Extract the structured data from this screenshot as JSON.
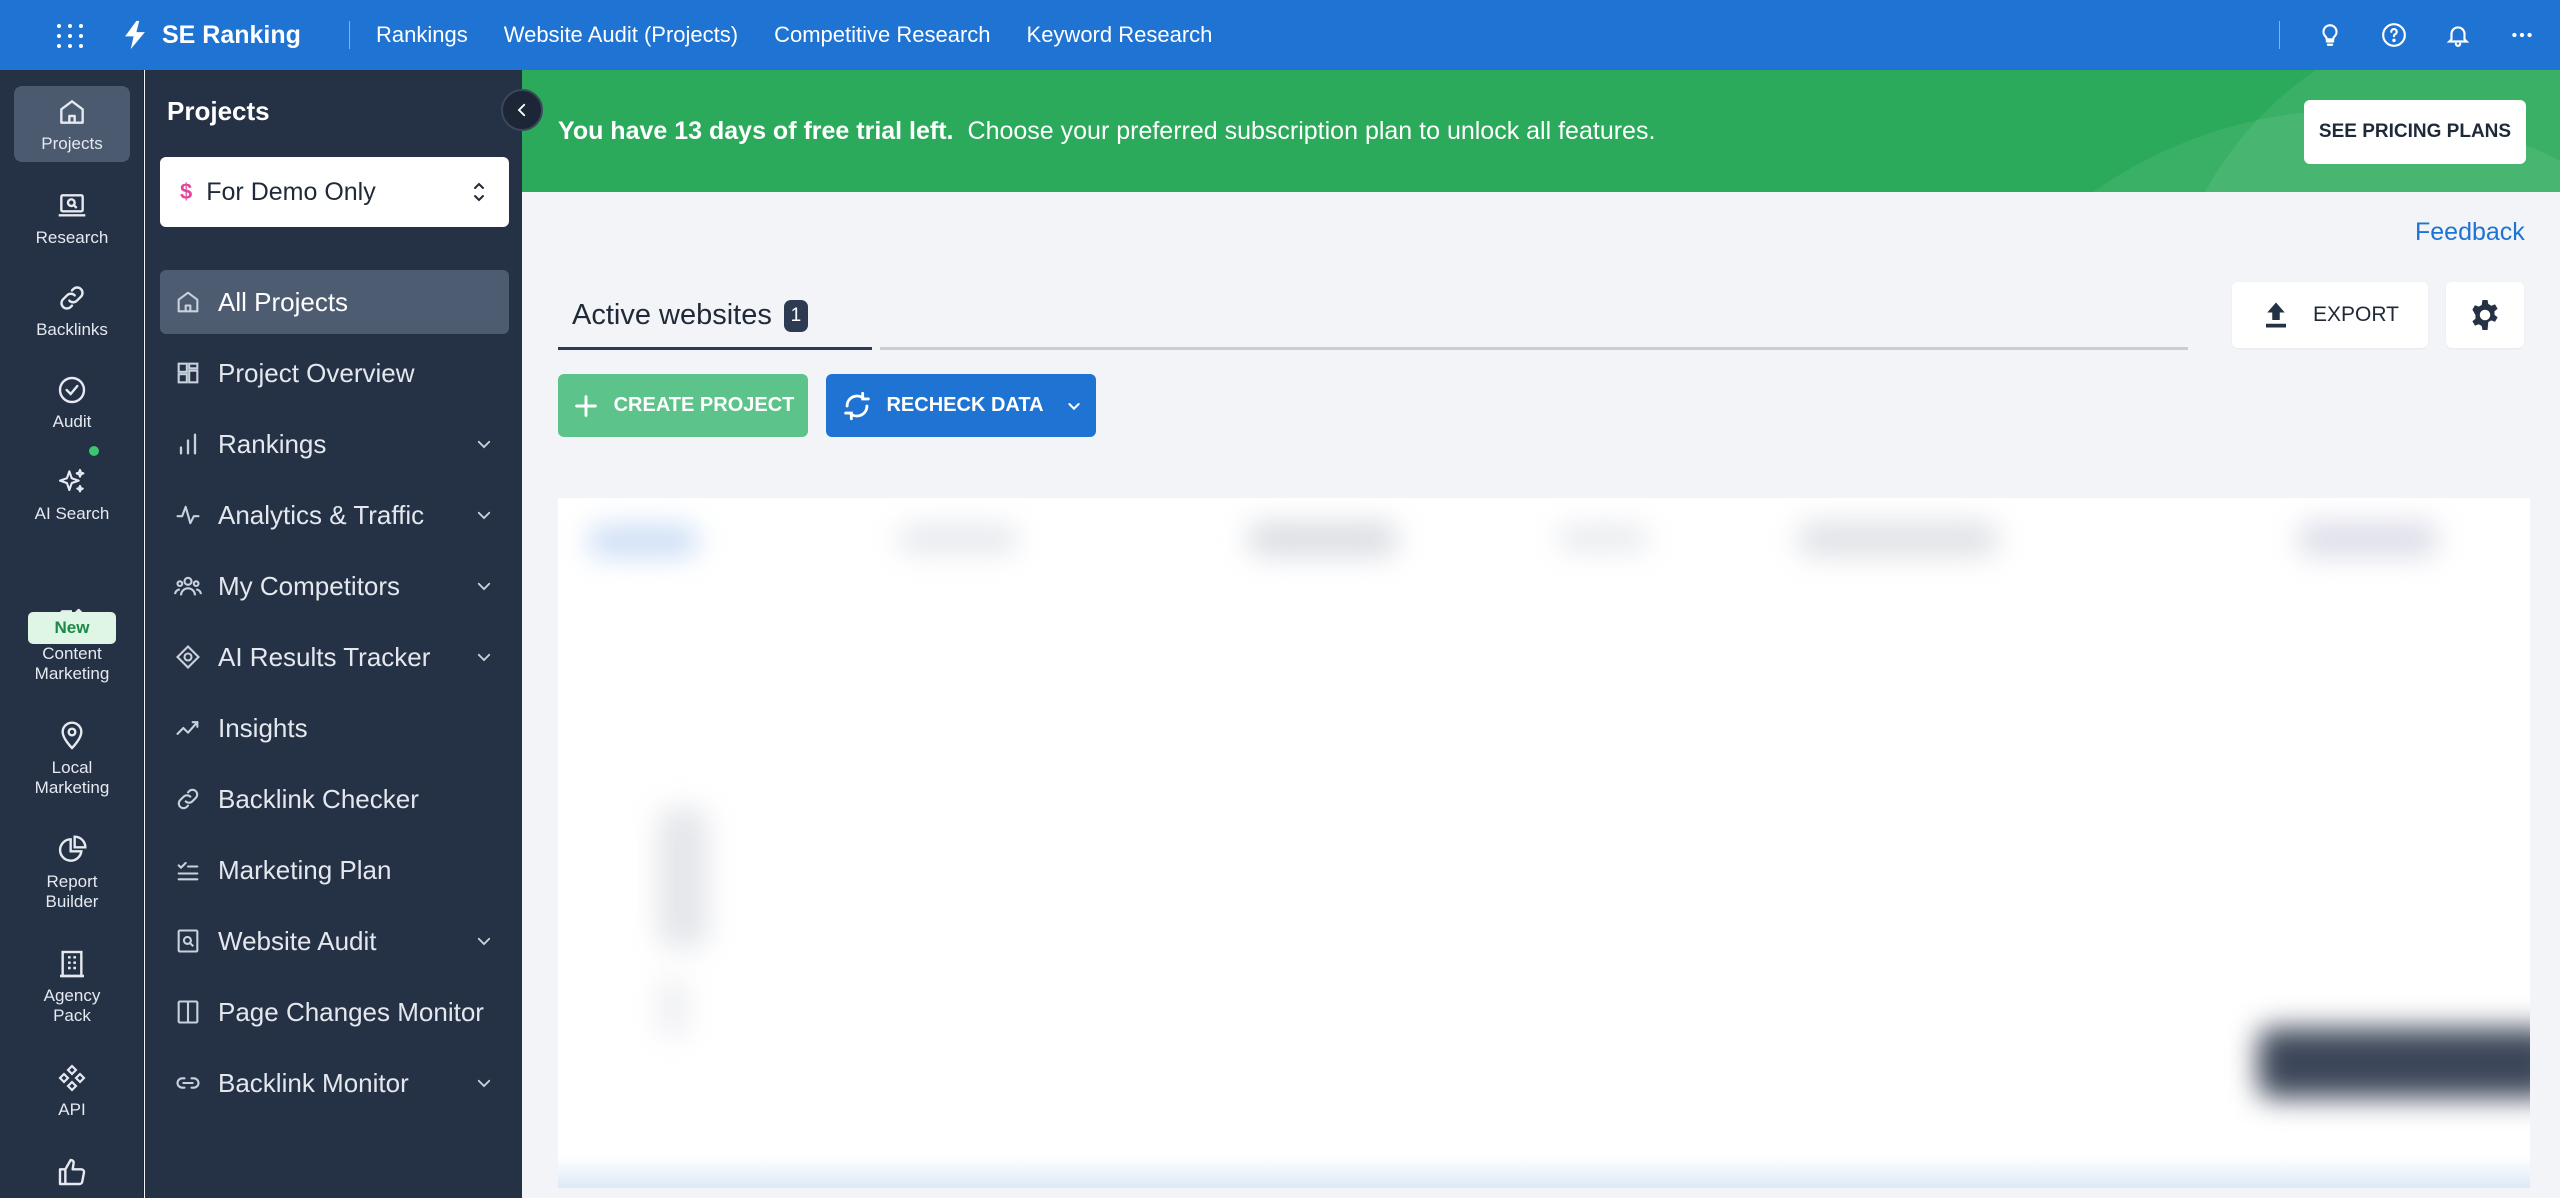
{
  "topbar": {
    "brand": "SE Ranking",
    "nav": [
      "Rankings",
      "Website Audit (Projects)",
      "Competitive Research",
      "Keyword Research"
    ],
    "icons": [
      "lightbulb-icon",
      "help-icon",
      "bell-icon",
      "more-icon"
    ]
  },
  "rail": {
    "items": [
      {
        "label": "Projects",
        "icon": "home-icon"
      },
      {
        "label": "Research",
        "icon": "research-icon"
      },
      {
        "label": "Backlinks",
        "icon": "link-icon"
      },
      {
        "label": "Audit",
        "icon": "check-circle-icon"
      },
      {
        "label": "AI Search",
        "icon": "sparkles-icon"
      },
      {
        "label": "Content\nMarketing",
        "icon": "edit-icon"
      },
      {
        "label": "Local\nMarketing",
        "icon": "map-pin-icon"
      },
      {
        "label": "Report\nBuilder",
        "icon": "pie-chart-icon"
      },
      {
        "label": "Agency\nPack",
        "icon": "building-icon"
      },
      {
        "label": "API",
        "icon": "api-icon"
      }
    ],
    "new_badge": "New"
  },
  "sidebar": {
    "title": "Projects",
    "project": {
      "symbol": "$",
      "name": "For Demo Only"
    },
    "items": [
      {
        "label": "All Projects",
        "icon": "home-icon",
        "expandable": false
      },
      {
        "label": "Project Overview",
        "icon": "dashboard-icon",
        "expandable": false
      },
      {
        "label": "Rankings",
        "icon": "bar-chart-icon",
        "expandable": true
      },
      {
        "label": "Analytics & Traffic",
        "icon": "pulse-icon",
        "expandable": true
      },
      {
        "label": "My Competitors",
        "icon": "users-icon",
        "expandable": true
      },
      {
        "label": "AI Results Tracker",
        "icon": "ai-tracker-icon",
        "expandable": true
      },
      {
        "label": "Insights",
        "icon": "trend-icon",
        "expandable": false
      },
      {
        "label": "Backlink Checker",
        "icon": "link-icon",
        "expandable": false
      },
      {
        "label": "Marketing Plan",
        "icon": "checklist-icon",
        "expandable": false
      },
      {
        "label": "Website Audit",
        "icon": "audit-icon",
        "expandable": true
      },
      {
        "label": "Page Changes Monitor",
        "icon": "page-changes-icon",
        "expandable": false
      },
      {
        "label": "Backlink Monitor",
        "icon": "chain-icon",
        "expandable": true
      }
    ]
  },
  "banner": {
    "bold": "You have 13 days of free trial left.",
    "text": "Choose your preferred subscription plan to unlock all features.",
    "button": "SEE PRICING PLANS"
  },
  "main": {
    "feedback": "Feedback",
    "tab": {
      "label": "Active websites",
      "count": "1"
    },
    "export": "EXPORT",
    "create": "CREATE PROJECT",
    "recheck": "RECHECK DATA"
  },
  "colors": {
    "topbar": "#1e73d3",
    "sidebar": "#253144",
    "banner": "#2aaa5a",
    "create_button": "#5cc48a",
    "accent": "#1e73d3"
  }
}
